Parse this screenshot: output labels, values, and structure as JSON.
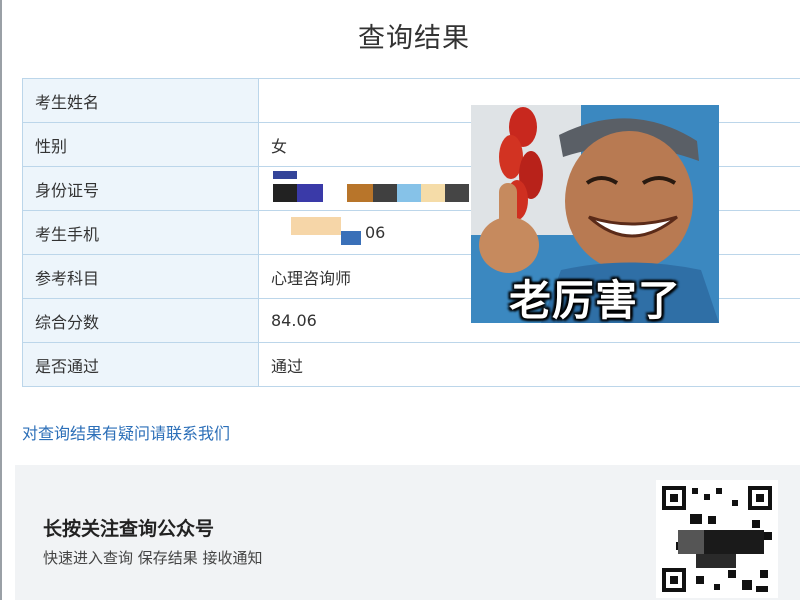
{
  "page": {
    "title": "查询结果"
  },
  "result_rows": [
    {
      "label": "考生姓名",
      "value": ""
    },
    {
      "label": "性别",
      "value": "女"
    },
    {
      "label": "身份证号",
      "value": ""
    },
    {
      "label": "考生手机",
      "value": "06"
    },
    {
      "label": "参考科目",
      "value": "心理咨询师"
    },
    {
      "label": "综合分数",
      "value": "84.06"
    },
    {
      "label": "是否通过",
      "value": "通过"
    }
  ],
  "contact_link": "对查询结果有疑问请联系我们",
  "follow": {
    "title": "长按关注查询公众号",
    "subtitle": "快速进入查询 保存结果 接收通知"
  },
  "meme": {
    "caption": "老厉害了"
  },
  "colors": {
    "label_bg": "#edf5fb",
    "border": "#bcd6ea",
    "link": "#2c6fb8",
    "footer_bg": "#f1f3f5"
  },
  "icons": {
    "qr": "qr-code-icon"
  }
}
